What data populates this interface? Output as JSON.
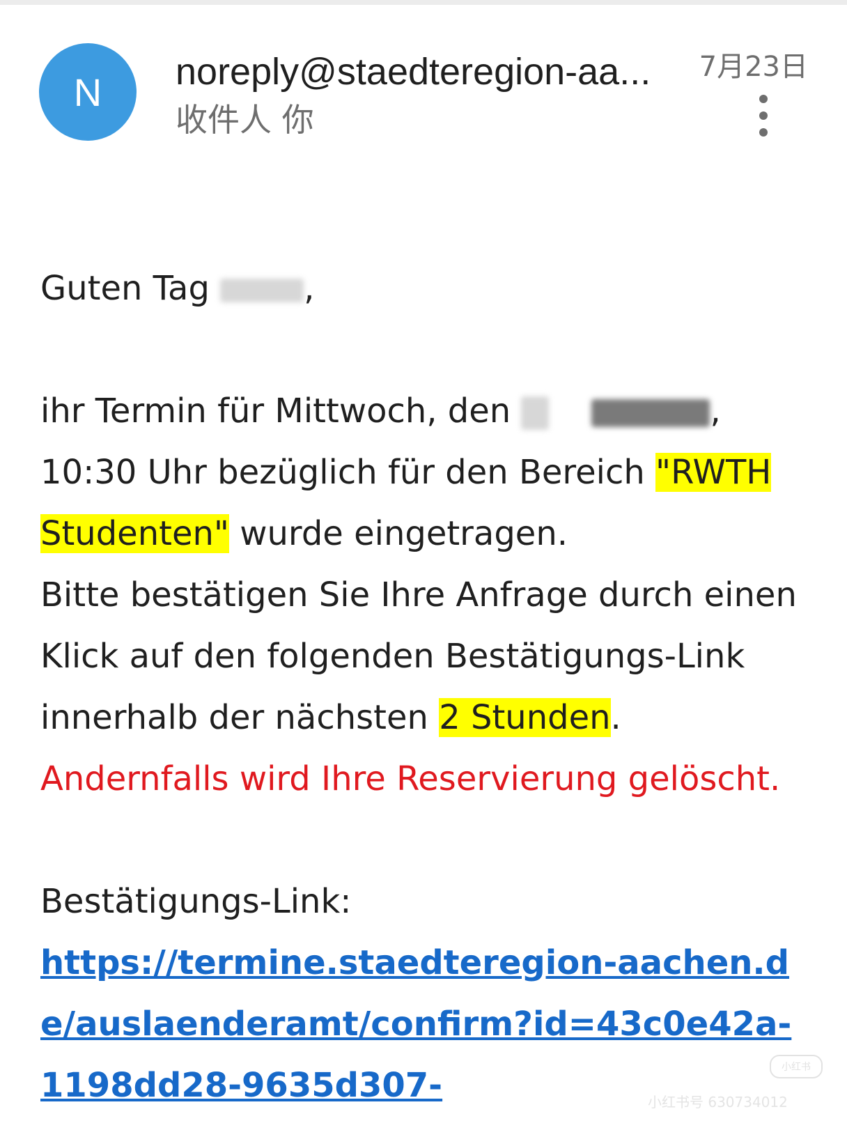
{
  "header": {
    "avatar_letter": "N",
    "sender": "noreply@staedteregion-aa...",
    "recipient": "收件人 你",
    "date": "7月23日"
  },
  "body": {
    "greeting": "Guten Tag ",
    "greeting_end": ",",
    "line1": "ihr Termin für Mittwoch, den ",
    "line1_end": ",",
    "line2": "10:30 Uhr bezüglich für den Bereich ",
    "highlight1": "\"RWTH Studenten\"",
    "line3_rest": " wurde eingetragen.",
    "confirm1": "Bitte bestätigen Sie Ihre Anfrage durch einen Klick auf den folgenden Bestätigungs-Link innerhalb der nächsten ",
    "highlight2": "2 Stunden",
    "period": ". ",
    "warning": "Andernfalls wird Ihre Reservierung gelöscht.",
    "link_label": "Bestätigungs-Link:",
    "link": "https://termine.staedteregion-aachen.de/auslaenderamt/confirm?id=43c0e42a-1198dd28-9635d307-"
  },
  "watermark": {
    "badge": "小红书",
    "id": "小红书号 630734012"
  },
  "colors": {
    "avatar": "#3d9be0",
    "highlight": "#ffff00",
    "warning": "#e0191f",
    "link": "#1769c9"
  }
}
